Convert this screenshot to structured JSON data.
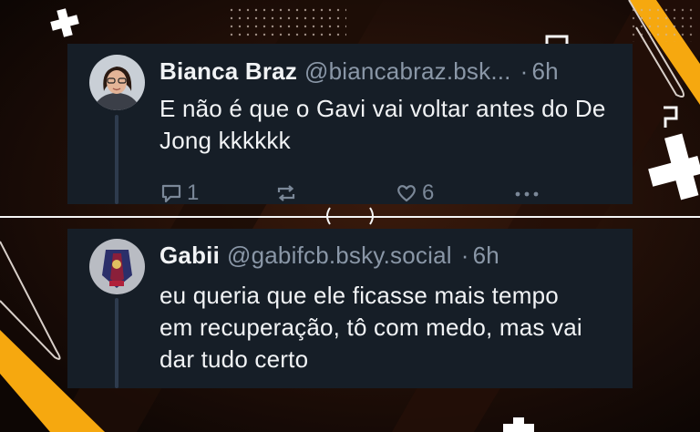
{
  "posts": [
    {
      "author_name": "Bianca Braz",
      "handle": "@biancabraz.bsk...",
      "separator": "·",
      "time": "6h",
      "text": "E não é que o Gavi vai voltar antes do De Jong kkkkkk",
      "reply_count": "1",
      "like_count": "6",
      "icons": [
        "reply-icon",
        "repost-icon",
        "like-icon",
        "more-icon"
      ]
    },
    {
      "author_name": "Gabii",
      "handle": "@gabifcb.bsky.social",
      "separator": "·",
      "time": "6h",
      "text": "eu queria que ele ficasse mais tempo em recuperação, tô com medo, mas vai dar tudo certo"
    }
  ],
  "colors": {
    "background": "#140a06",
    "card": "#161e27",
    "text_primary": "#f1f3f5",
    "text_secondary": "#8a97a7",
    "thread_line": "#2e3b4d",
    "accent_yellow": "#f6a80f"
  }
}
